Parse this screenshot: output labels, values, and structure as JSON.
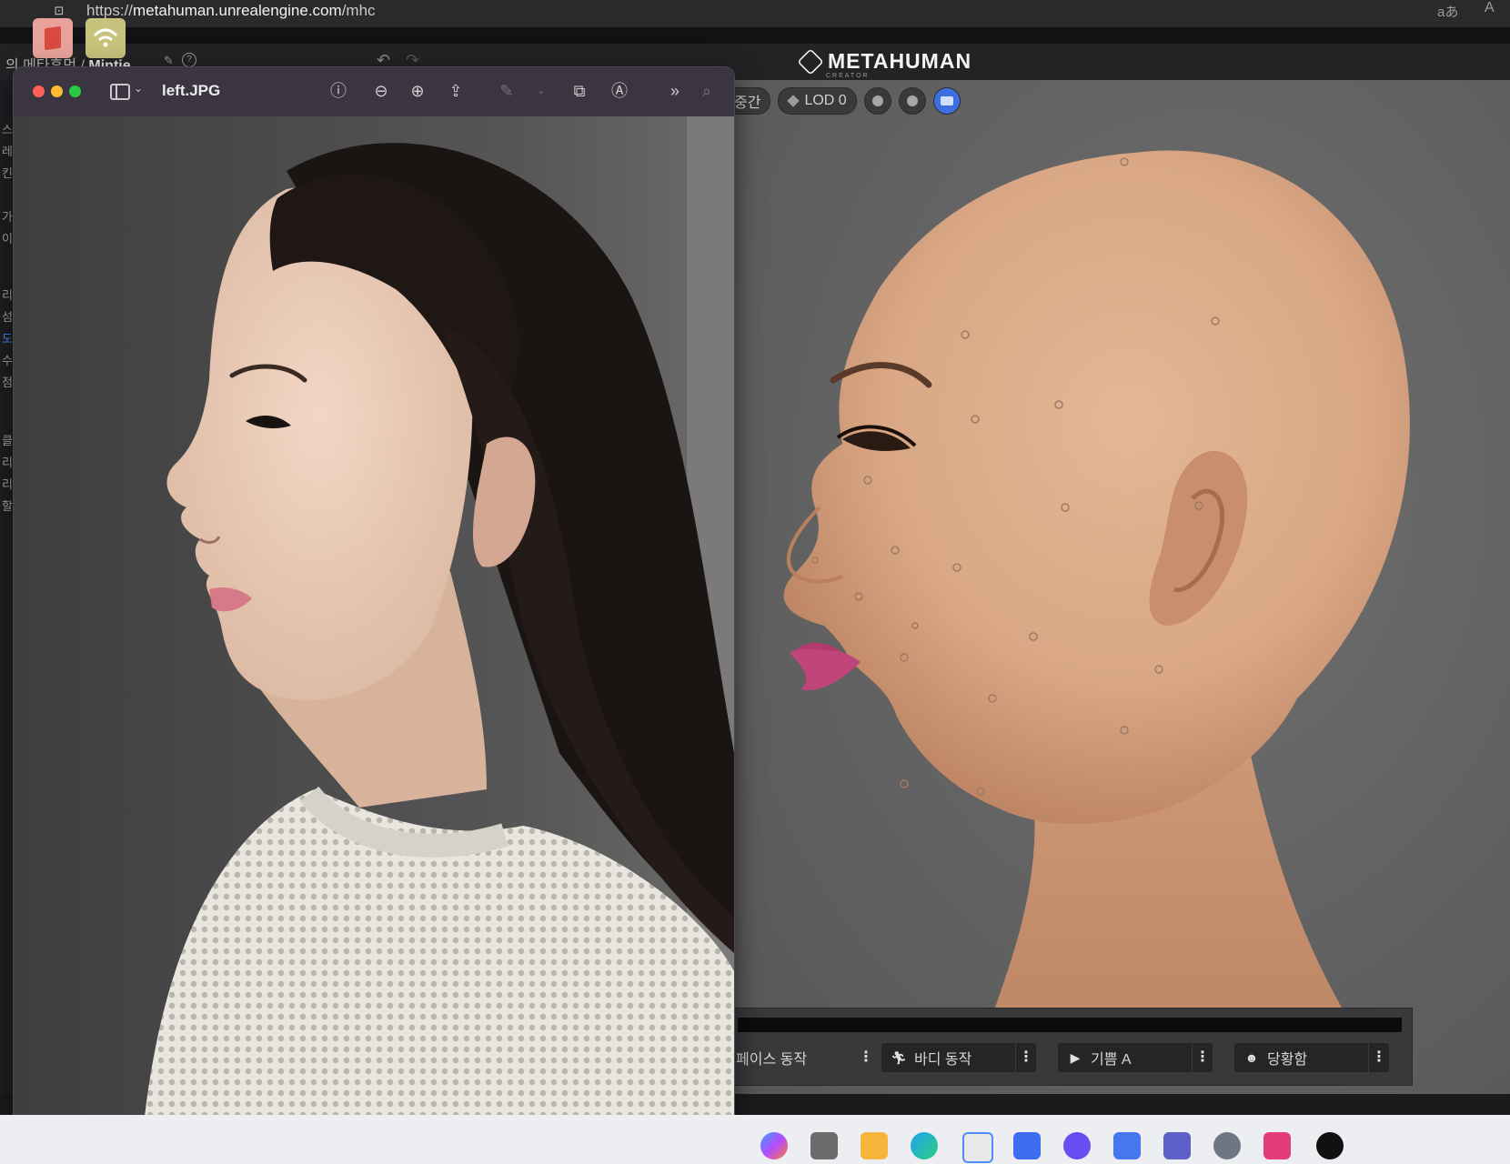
{
  "browser": {
    "url_scheme": "https://",
    "url_host": "metahuman.unrealengine.com",
    "url_path": "/mhc",
    "read_aloud": "aあ",
    "font_size": "A"
  },
  "mh_header": {
    "breadcrumb_prefix": "의 메타휴먼 /",
    "character_name": "Mintie",
    "logo_text": "METAHUMAN",
    "logo_subtext": "CREATOR"
  },
  "side_menu_chars": [
    "스",
    "레",
    "킨",
    "가",
    "이",
    "리",
    "섬",
    "도",
    "수",
    "점",
    "클",
    "리",
    "리",
    "할"
  ],
  "viewport": {
    "toolbar": {
      "time_label": "중간",
      "lod_label": "LOD 0"
    },
    "expression_buttons": [
      {
        "icon": "face-motion-icon",
        "label": "페이스 동작"
      },
      {
        "icon": "run-icon",
        "label": "바디 동작"
      },
      {
        "icon": "play-icon",
        "label": "기쁨 A"
      },
      {
        "icon": "face-icon",
        "label": "당황함"
      }
    ]
  },
  "preview_window": {
    "title": "left.JPG",
    "tools": [
      "info-icon",
      "zoom-out-icon",
      "zoom-in-icon",
      "share-icon",
      "markup-icon",
      "rotate-icon",
      "annotate-icon",
      "more-icon",
      "search-icon"
    ]
  },
  "taskbar_icons": [
    "copilot-icon",
    "task-view-icon",
    "file-explorer-icon",
    "edge-icon",
    "store-icon",
    "widgets-icon",
    "app-icon",
    "app2-icon",
    "teams-icon",
    "settings-icon",
    "app3-icon",
    "unreal-icon"
  ],
  "colors": {
    "accent_blue": "#3d6fe0",
    "viewport_bg": "#636363",
    "traffic_red": "#ff5f57",
    "traffic_yellow": "#febc2e",
    "traffic_green": "#28c840"
  }
}
